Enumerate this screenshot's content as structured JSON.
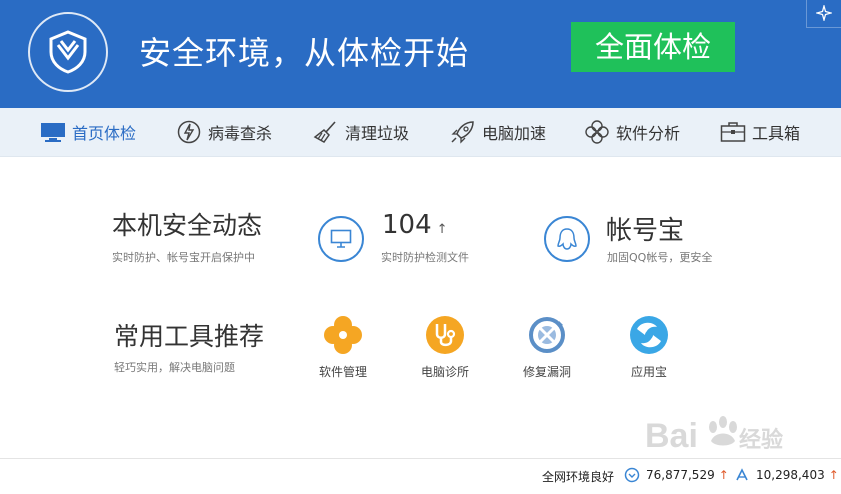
{
  "header": {
    "slogan": "安全环境，从体检开始",
    "checkup_button": "全面体检"
  },
  "nav": {
    "items": [
      {
        "label": "首页体检",
        "icon": "monitor-icon"
      },
      {
        "label": "病毒查杀",
        "icon": "lightning-icon"
      },
      {
        "label": "清理垃圾",
        "icon": "broom-icon"
      },
      {
        "label": "电脑加速",
        "icon": "rocket-icon"
      },
      {
        "label": "软件分析",
        "icon": "fan-icon"
      },
      {
        "label": "工具箱",
        "icon": "toolbox-icon"
      }
    ],
    "active_index": 0
  },
  "security": {
    "title": "本机安全动态",
    "subtitle": "实时防护、帐号宝开启保护中",
    "files_count": "104",
    "files_trend": "↑",
    "files_label": "实时防护检测文件",
    "account_title": "帐号宝",
    "account_label": "加固QQ帐号，更安全"
  },
  "tools": {
    "title": "常用工具推荐",
    "subtitle": "轻巧实用，解决电脑问题",
    "items": [
      {
        "label": "软件管理",
        "icon": "software-manager-icon",
        "color": "#f5a623"
      },
      {
        "label": "电脑诊所",
        "icon": "stethoscope-icon",
        "color": "#f5a623"
      },
      {
        "label": "修复漏洞",
        "icon": "patch-icon",
        "color": "#5b8fc7"
      },
      {
        "label": "应用宝",
        "icon": "app-store-icon",
        "color": "#3aa7e6"
      }
    ]
  },
  "status": {
    "network": "全网环境良好",
    "count1": "76,877,529",
    "count2": "10,298,403",
    "trend": "↑"
  },
  "watermark": {
    "text_latin": "Bai",
    "text_latin2": "du",
    "text_cn": "经验"
  },
  "colors": {
    "header_bg": "#2a6cc4",
    "button_green": "#1fc15a",
    "nav_bg": "#eaf1f8",
    "accent_blue": "#3a86d4",
    "tool_orange": "#f5a623"
  }
}
